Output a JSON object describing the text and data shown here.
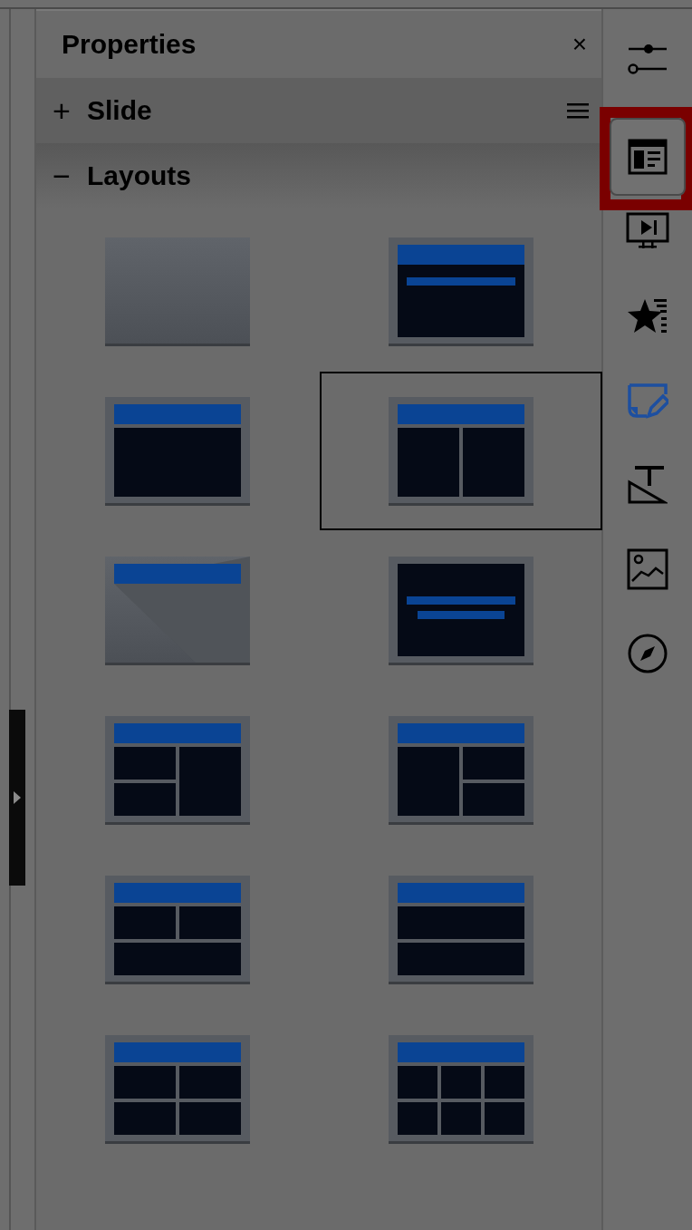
{
  "panel": {
    "title": "Properties",
    "close": "×"
  },
  "sections": [
    {
      "toggle": "+",
      "label": "Slide",
      "expanded": false,
      "has_menu": true
    },
    {
      "toggle": "−",
      "label": "Layouts",
      "expanded": true,
      "has_menu": false
    }
  ],
  "layouts": [
    {
      "kind": "blank",
      "selected": false
    },
    {
      "kind": "title-slide",
      "selected": false
    },
    {
      "kind": "title-content",
      "selected": false
    },
    {
      "kind": "title-two-content",
      "selected": true
    },
    {
      "kind": "title-only",
      "selected": false
    },
    {
      "kind": "centered-text",
      "selected": false
    },
    {
      "kind": "left-split",
      "selected": false
    },
    {
      "kind": "right-split",
      "selected": false
    },
    {
      "kind": "two-over-one",
      "selected": false
    },
    {
      "kind": "stacked",
      "selected": false
    },
    {
      "kind": "four-content",
      "selected": false
    },
    {
      "kind": "six-content",
      "selected": false
    }
  ],
  "deck_tabs": [
    {
      "kind": "sliders",
      "selected": false,
      "highlighted": false
    },
    {
      "kind": "layout",
      "selected": true,
      "highlighted": true
    },
    {
      "kind": "transition",
      "selected": false,
      "highlighted": false
    },
    {
      "kind": "animation",
      "selected": false,
      "highlighted": false
    },
    {
      "kind": "master",
      "selected": false,
      "highlighted": false
    },
    {
      "kind": "styles",
      "selected": false,
      "highlighted": false
    },
    {
      "kind": "gallery",
      "selected": false,
      "highlighted": false
    },
    {
      "kind": "navigator",
      "selected": false,
      "highlighted": false
    }
  ]
}
